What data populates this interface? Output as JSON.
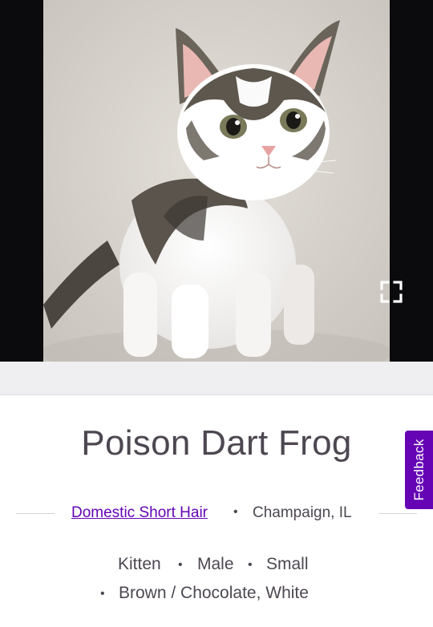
{
  "pet": {
    "name": "Poison Dart Frog",
    "breed": "Domestic Short Hair",
    "location": "Champaign, IL",
    "age": "Kitten",
    "gender": "Male",
    "size": "Small",
    "colors": "Brown / Chocolate, White"
  },
  "separators": {
    "dot": "•"
  },
  "photo": {
    "icon": "expand-icon"
  },
  "feedback": {
    "label": "Feedback"
  },
  "colors": {
    "accent": "#6504b5",
    "text": "#4d4751",
    "letterbox": "#0b0a0d",
    "band": "#efeff2"
  }
}
